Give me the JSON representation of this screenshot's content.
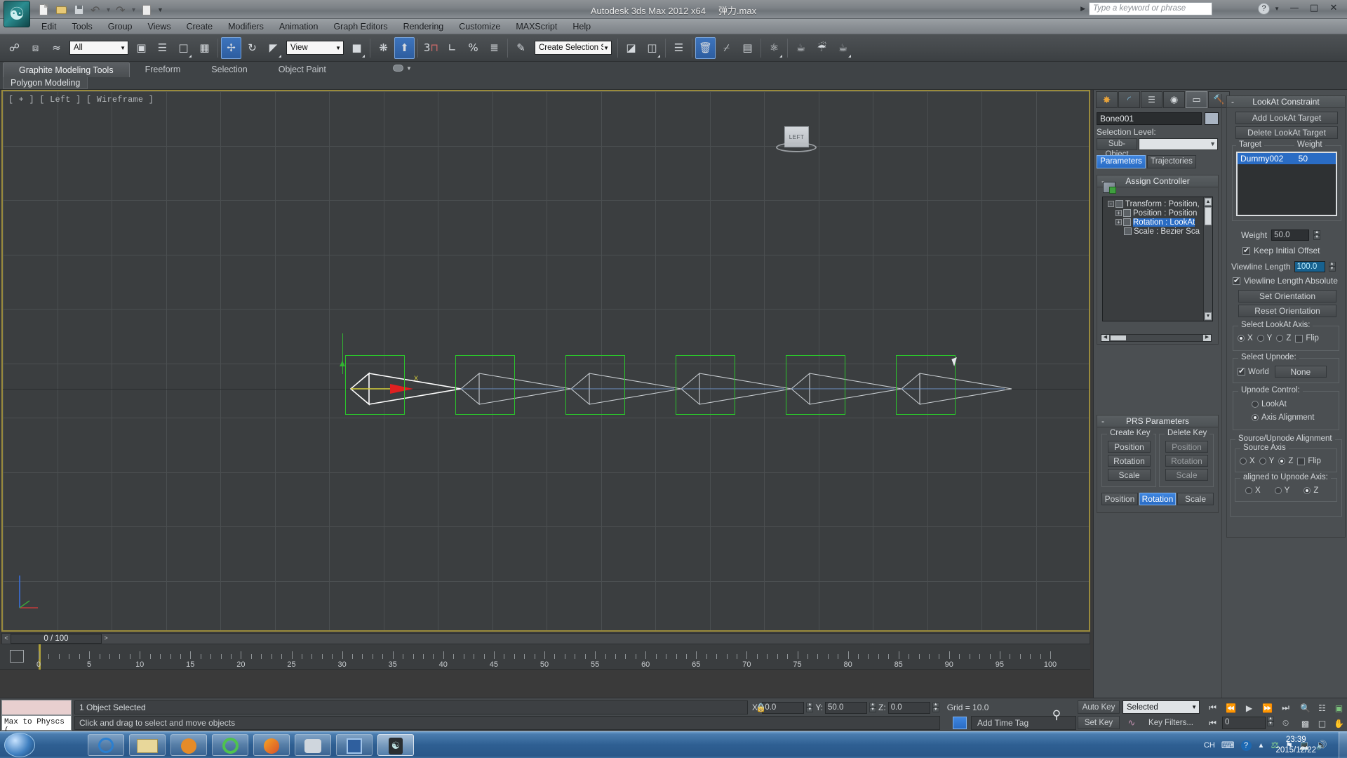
{
  "window": {
    "title": "Autodesk 3ds Max  2012 x64",
    "filename": "弹力.max",
    "search_placeholder": "Type a keyword or phrase",
    "minimize": "—",
    "maximize": "□",
    "close": "✕",
    "help": "?"
  },
  "quick_access": [
    "new-icon",
    "open-icon",
    "save-icon",
    "undo-icon",
    "redo-icon",
    "set-project-icon",
    "customize-qat-icon"
  ],
  "menu": [
    "Edit",
    "Tools",
    "Group",
    "Views",
    "Create",
    "Modifiers",
    "Animation",
    "Graph Editors",
    "Rendering",
    "Customize",
    "MAXScript",
    "Help"
  ],
  "toolbar": {
    "selection_filter": "All",
    "reference_coord": "View",
    "named_selection_sets": "Create Selection Set",
    "buttons": [
      "select-and-link-icon",
      "unlink-selection-icon",
      "bind-to-space-warp-icon",
      "select-object-icon",
      "select-by-name-icon",
      "rectangular-selection-region-icon",
      "window-crossing-icon",
      "select-and-move-icon",
      "select-and-rotate-icon",
      "select-and-scale-icon",
      "use-pivot-point-center-icon",
      "select-and-manipulate-icon",
      "snaps-toggle-icon",
      "angle-snap-toggle-icon",
      "percent-snap-toggle-icon",
      "spinner-snap-toggle-icon",
      "edit-named-selection-sets-icon",
      "mirror-icon",
      "align-icon",
      "layer-manager-icon",
      "graphite-toggle-icon",
      "curve-editor-icon",
      "schematic-view-icon",
      "material-editor-icon",
      "render-setup-icon",
      "rendered-frame-window-icon",
      "render-production-icon"
    ]
  },
  "ribbon": {
    "tabs": [
      "Graphite Modeling Tools",
      "Freeform",
      "Selection",
      "Object Paint"
    ],
    "selected_tab": "Graphite Modeling Tools",
    "subbar": "Polygon Modeling"
  },
  "viewport": {
    "label": "[ + ] [ Left ] [ Wireframe ]",
    "viewcube_face": "LEFT",
    "bone_count": 6,
    "axis_label_x": "X"
  },
  "command_panel": {
    "tabs": [
      "create-tab-icon",
      "modify-tab-icon",
      "hierarchy-tab-icon",
      "motion-tab-icon",
      "display-tab-icon",
      "utilities-tab-icon"
    ],
    "selected_tab_index": 4,
    "object_name": "Bone001",
    "selection_level_label": "Selection Level:",
    "sub_object_button": "Sub-Object",
    "sub_object_value": "",
    "param_tabs": [
      "Parameters",
      "Trajectories"
    ],
    "param_tab_selected": "Parameters",
    "assign_controller": {
      "title": "Assign Controller",
      "minus": "-",
      "tree": [
        {
          "label": "Transform : Position,",
          "expander": "-",
          "depth": 0,
          "selected": false
        },
        {
          "label": "Position : Position",
          "expander": "+",
          "depth": 1,
          "selected": false
        },
        {
          "label": "Rotation : LookAt",
          "expander": "+",
          "depth": 1,
          "selected": true
        },
        {
          "label": "Scale : Bezier Sca",
          "expander": "",
          "depth": 1,
          "selected": false
        }
      ]
    },
    "prs": {
      "title": "PRS Parameters",
      "minus": "-",
      "create_key_title": "Create Key",
      "delete_key_title": "Delete Key",
      "create_key": [
        "Position",
        "Rotation",
        "Scale"
      ],
      "delete_key": [
        "Position",
        "Rotation",
        "Scale"
      ],
      "mode_buttons": [
        "Position",
        "Rotation",
        "Scale"
      ],
      "mode_selected": "Rotation"
    }
  },
  "lookat": {
    "title": "LookAt Constraint",
    "minus": "-",
    "add_target": "Add LookAt Target",
    "delete_target": "Delete LookAt Target",
    "col_target": "Target",
    "col_weight": "Weight",
    "targets": [
      {
        "name": "Dummy002",
        "weight": "50",
        "selected": true
      }
    ],
    "weight_label": "Weight",
    "weight_value": "50.0",
    "keep_initial_offset_label": "Keep Initial Offset",
    "keep_initial_offset": true,
    "viewline_length_label": "Viewline Length",
    "viewline_length_value": "100.0",
    "viewline_absolute_label": "Viewline Length Absolute",
    "viewline_absolute": true,
    "set_orientation": "Set Orientation",
    "reset_orientation": "Reset Orientation",
    "select_lookat_axis_title": "Select LookAt Axis:",
    "lookat_axes": [
      "X",
      "Y",
      "Z"
    ],
    "lookat_axis_selected": "X",
    "lookat_flip_label": "Flip",
    "lookat_flip": false,
    "select_upnode_title": "Select Upnode:",
    "world_label": "World",
    "world_checked": true,
    "upnode_none": "None",
    "upnode_control_title": "Upnode Control:",
    "upnode_control_options": [
      "LookAt",
      "Axis Alignment"
    ],
    "upnode_control_selected": "Axis Alignment",
    "source_upnode_title": "Source/Upnode Alignment",
    "source_axis_title": "Source Axis",
    "source_axes": [
      "X",
      "Y",
      "Z"
    ],
    "source_axis_selected": "Z",
    "source_flip_label": "Flip",
    "source_flip": false,
    "aligned_title": "aligned to Upnode Axis:",
    "aligned_axes": [
      "X",
      "Y",
      "Z"
    ],
    "aligned_axis_selected": "Z"
  },
  "timeline": {
    "frame_readout": "0 / 100",
    "prev_arrow": "<",
    "next_arrow": ">",
    "range_start": 0,
    "range_end": 100,
    "labels": [
      0,
      5,
      10,
      15,
      20,
      25,
      30,
      35,
      40,
      45,
      50,
      55,
      60,
      65,
      70,
      75,
      80,
      85,
      90,
      95,
      100
    ],
    "current_frame": 0
  },
  "status": {
    "maxscript_mini_listener": "Max to Physcs (",
    "selection_text": "1 Object Selected",
    "prompt_text": "Click and drag to select and move objects",
    "lock_icon": "lock-selection-icon",
    "coord_icon": "absolute-relative-transform-icon",
    "x_label": "X:",
    "x_value": "0.0",
    "y_label": "Y:",
    "y_value": "50.0",
    "z_label": "Z:",
    "z_value": "0.0",
    "grid_text": "Grid = 10.0",
    "add_time_tag": "Add Time Tag",
    "key_mode_icon": "key-mode-toggle-icon"
  },
  "animation": {
    "auto_key": "Auto Key",
    "set_key": "Set Key",
    "key_filter_set": "Selected",
    "key_filters": "Key Filters...",
    "current_frame_field": "0",
    "playback_buttons": [
      "go-to-start-icon",
      "previous-frame-icon",
      "play-animation-icon",
      "next-frame-icon",
      "go-to-end-icon"
    ],
    "viewport_nav": [
      "zoom-icon",
      "zoom-all-icon",
      "zoom-extents-icon",
      "zoom-region-icon",
      "field-of-view-icon",
      "pan-view-icon",
      "orbit-icon",
      "maximize-viewport-toggle-icon"
    ]
  },
  "taskbar": {
    "start": "windows-start-orb",
    "items": [
      "internet-explorer-icon",
      "windows-explorer-icon",
      "media-player-icon",
      "browser-icon",
      "firefox-like-icon",
      "image-tool-icon",
      "film-tool-icon",
      "3dsmax-icon"
    ],
    "tray": [
      "CH",
      "keyboard-icon",
      "help-icon",
      "expand-tray-icon",
      "usb-icon",
      "network-icon",
      "sound-icon"
    ],
    "time": "23:39",
    "date": "2015/12/22"
  }
}
